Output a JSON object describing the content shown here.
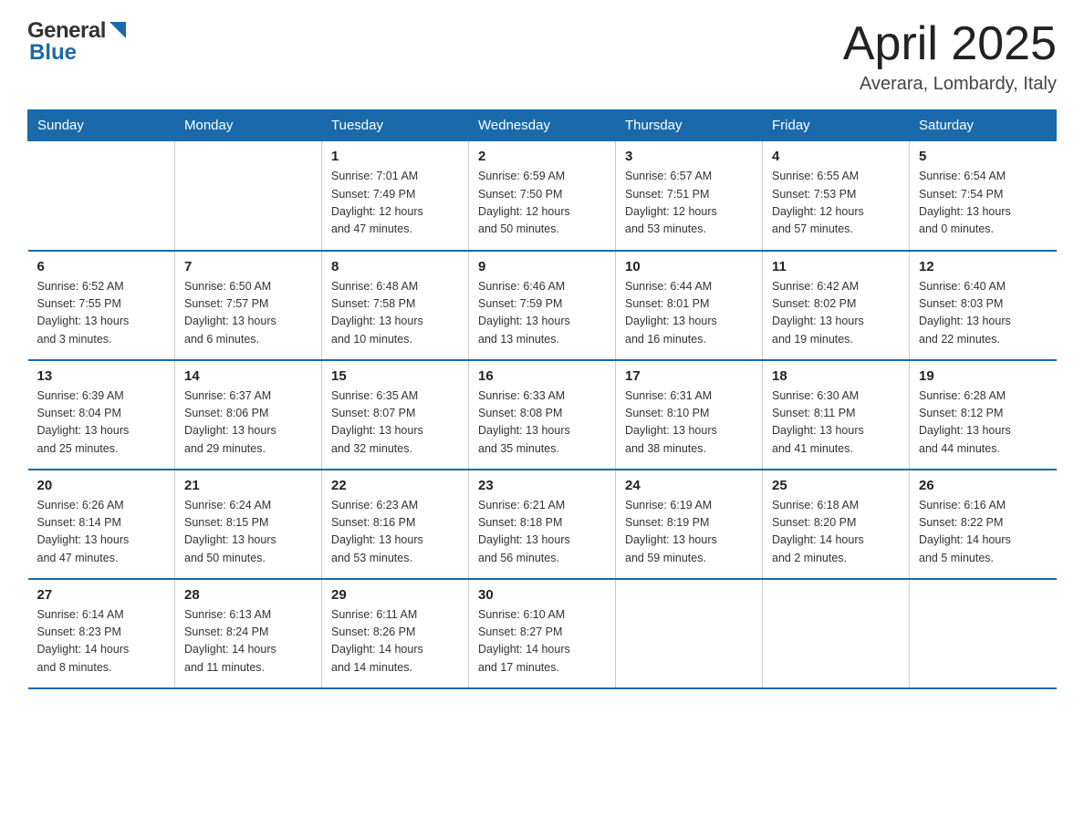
{
  "header": {
    "logo_general": "General",
    "logo_blue": "Blue",
    "month_title": "April 2025",
    "location": "Averara, Lombardy, Italy"
  },
  "weekdays": [
    "Sunday",
    "Monday",
    "Tuesday",
    "Wednesday",
    "Thursday",
    "Friday",
    "Saturday"
  ],
  "weeks": [
    [
      {
        "day": "",
        "info": ""
      },
      {
        "day": "",
        "info": ""
      },
      {
        "day": "1",
        "info": "Sunrise: 7:01 AM\nSunset: 7:49 PM\nDaylight: 12 hours\nand 47 minutes."
      },
      {
        "day": "2",
        "info": "Sunrise: 6:59 AM\nSunset: 7:50 PM\nDaylight: 12 hours\nand 50 minutes."
      },
      {
        "day": "3",
        "info": "Sunrise: 6:57 AM\nSunset: 7:51 PM\nDaylight: 12 hours\nand 53 minutes."
      },
      {
        "day": "4",
        "info": "Sunrise: 6:55 AM\nSunset: 7:53 PM\nDaylight: 12 hours\nand 57 minutes."
      },
      {
        "day": "5",
        "info": "Sunrise: 6:54 AM\nSunset: 7:54 PM\nDaylight: 13 hours\nand 0 minutes."
      }
    ],
    [
      {
        "day": "6",
        "info": "Sunrise: 6:52 AM\nSunset: 7:55 PM\nDaylight: 13 hours\nand 3 minutes."
      },
      {
        "day": "7",
        "info": "Sunrise: 6:50 AM\nSunset: 7:57 PM\nDaylight: 13 hours\nand 6 minutes."
      },
      {
        "day": "8",
        "info": "Sunrise: 6:48 AM\nSunset: 7:58 PM\nDaylight: 13 hours\nand 10 minutes."
      },
      {
        "day": "9",
        "info": "Sunrise: 6:46 AM\nSunset: 7:59 PM\nDaylight: 13 hours\nand 13 minutes."
      },
      {
        "day": "10",
        "info": "Sunrise: 6:44 AM\nSunset: 8:01 PM\nDaylight: 13 hours\nand 16 minutes."
      },
      {
        "day": "11",
        "info": "Sunrise: 6:42 AM\nSunset: 8:02 PM\nDaylight: 13 hours\nand 19 minutes."
      },
      {
        "day": "12",
        "info": "Sunrise: 6:40 AM\nSunset: 8:03 PM\nDaylight: 13 hours\nand 22 minutes."
      }
    ],
    [
      {
        "day": "13",
        "info": "Sunrise: 6:39 AM\nSunset: 8:04 PM\nDaylight: 13 hours\nand 25 minutes."
      },
      {
        "day": "14",
        "info": "Sunrise: 6:37 AM\nSunset: 8:06 PM\nDaylight: 13 hours\nand 29 minutes."
      },
      {
        "day": "15",
        "info": "Sunrise: 6:35 AM\nSunset: 8:07 PM\nDaylight: 13 hours\nand 32 minutes."
      },
      {
        "day": "16",
        "info": "Sunrise: 6:33 AM\nSunset: 8:08 PM\nDaylight: 13 hours\nand 35 minutes."
      },
      {
        "day": "17",
        "info": "Sunrise: 6:31 AM\nSunset: 8:10 PM\nDaylight: 13 hours\nand 38 minutes."
      },
      {
        "day": "18",
        "info": "Sunrise: 6:30 AM\nSunset: 8:11 PM\nDaylight: 13 hours\nand 41 minutes."
      },
      {
        "day": "19",
        "info": "Sunrise: 6:28 AM\nSunset: 8:12 PM\nDaylight: 13 hours\nand 44 minutes."
      }
    ],
    [
      {
        "day": "20",
        "info": "Sunrise: 6:26 AM\nSunset: 8:14 PM\nDaylight: 13 hours\nand 47 minutes."
      },
      {
        "day": "21",
        "info": "Sunrise: 6:24 AM\nSunset: 8:15 PM\nDaylight: 13 hours\nand 50 minutes."
      },
      {
        "day": "22",
        "info": "Sunrise: 6:23 AM\nSunset: 8:16 PM\nDaylight: 13 hours\nand 53 minutes."
      },
      {
        "day": "23",
        "info": "Sunrise: 6:21 AM\nSunset: 8:18 PM\nDaylight: 13 hours\nand 56 minutes."
      },
      {
        "day": "24",
        "info": "Sunrise: 6:19 AM\nSunset: 8:19 PM\nDaylight: 13 hours\nand 59 minutes."
      },
      {
        "day": "25",
        "info": "Sunrise: 6:18 AM\nSunset: 8:20 PM\nDaylight: 14 hours\nand 2 minutes."
      },
      {
        "day": "26",
        "info": "Sunrise: 6:16 AM\nSunset: 8:22 PM\nDaylight: 14 hours\nand 5 minutes."
      }
    ],
    [
      {
        "day": "27",
        "info": "Sunrise: 6:14 AM\nSunset: 8:23 PM\nDaylight: 14 hours\nand 8 minutes."
      },
      {
        "day": "28",
        "info": "Sunrise: 6:13 AM\nSunset: 8:24 PM\nDaylight: 14 hours\nand 11 minutes."
      },
      {
        "day": "29",
        "info": "Sunrise: 6:11 AM\nSunset: 8:26 PM\nDaylight: 14 hours\nand 14 minutes."
      },
      {
        "day": "30",
        "info": "Sunrise: 6:10 AM\nSunset: 8:27 PM\nDaylight: 14 hours\nand 17 minutes."
      },
      {
        "day": "",
        "info": ""
      },
      {
        "day": "",
        "info": ""
      },
      {
        "day": "",
        "info": ""
      }
    ]
  ]
}
